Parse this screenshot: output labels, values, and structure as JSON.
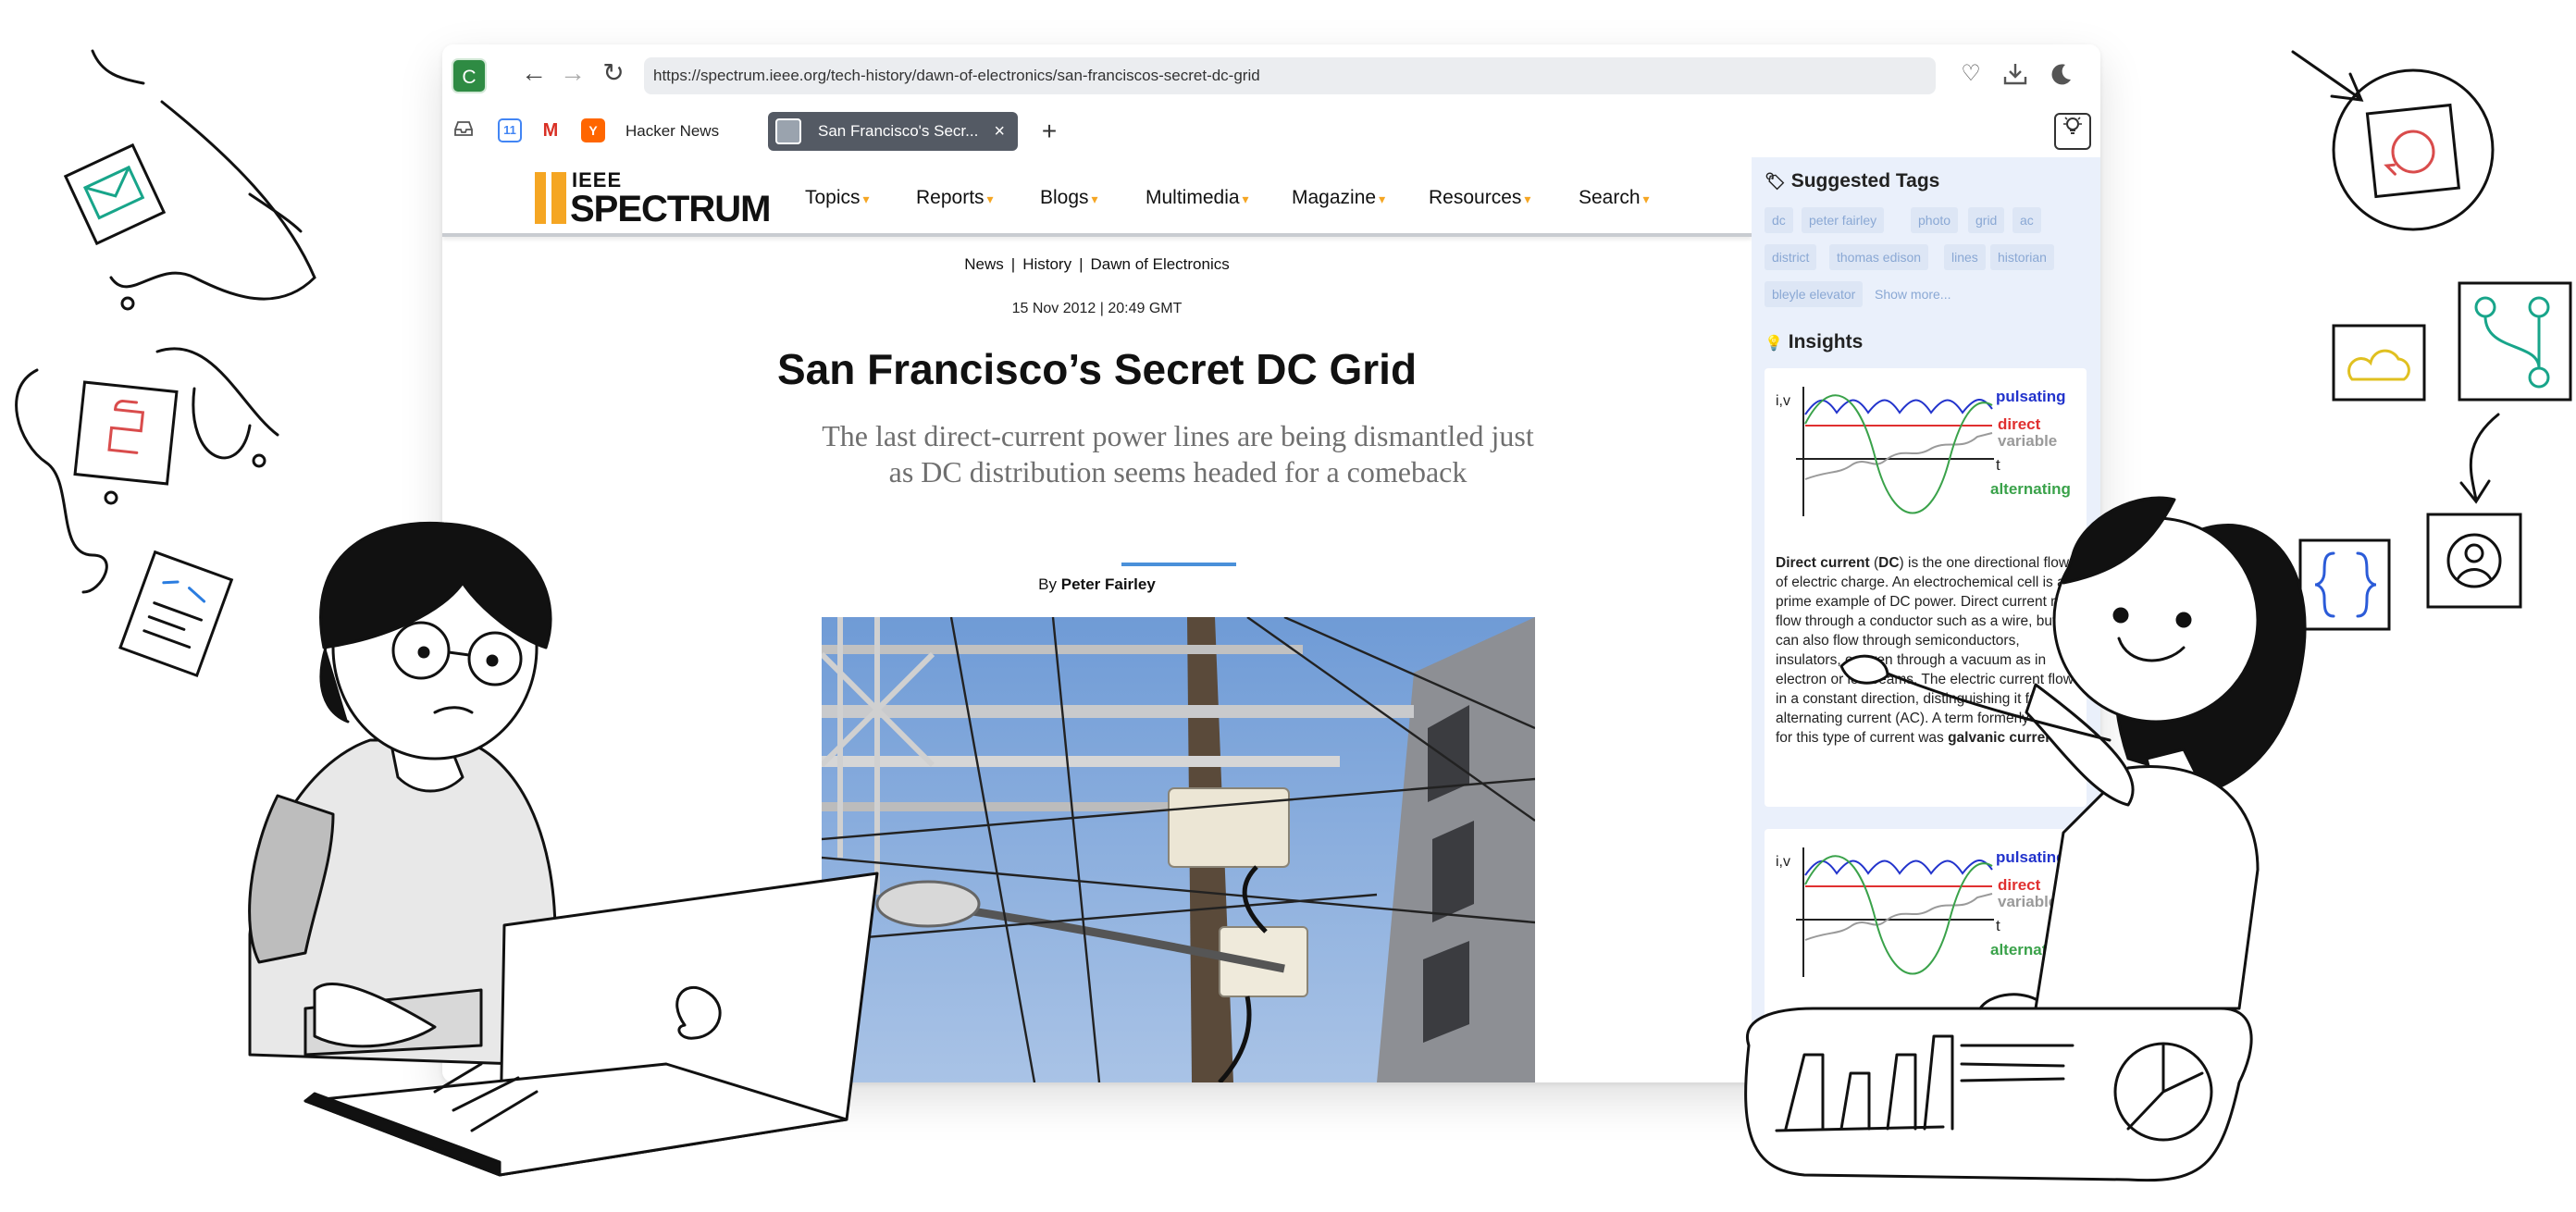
{
  "browser": {
    "extension_badge": "C",
    "url": "https://spectrum.ieee.org/tech-history/dawn-of-electronics/san-franciscos-secret-dc-grid"
  },
  "tabs": {
    "pinned": [
      {
        "icon": "inbox-icon"
      },
      {
        "icon": "calendar-icon",
        "text": "11"
      },
      {
        "icon": "gmail-icon",
        "text": "M"
      },
      {
        "icon": "hacker-news-icon",
        "text": "Y"
      }
    ],
    "hn_label": "Hacker News",
    "active_label": "San Francisco's Secr...",
    "close_glyph": "×",
    "new_tab_glyph": "+"
  },
  "site": {
    "logo_top": "IEEE",
    "logo_bottom": "SPECTRUM",
    "nav": [
      "Topics",
      "Reports",
      "Blogs",
      "Multimedia",
      "Magazine",
      "Resources",
      "Search"
    ]
  },
  "article": {
    "breadcrumbs": [
      "News",
      "History",
      "Dawn of Electronics"
    ],
    "dateline": "15 Nov 2012 | 20:49 GMT",
    "title": "San Francisco’s Secret DC Grid",
    "subtitle": "The last direct-current power lines are being dismantled just as DC distribution seems headed for a comeback",
    "byline_prefix": "By",
    "author": "Peter Fairley"
  },
  "sidebar": {
    "tags_title": "Suggested Tags",
    "tags": [
      "dc",
      "peter fairley",
      "photo",
      "grid",
      "ac",
      "district",
      "thomas edison",
      "lines",
      "historian",
      "bleyle elevator"
    ],
    "show_more": "Show more...",
    "insights_title": "Insights",
    "chart_labels": {
      "axis": "i,v",
      "pulsating": "pulsating",
      "direct": "direct",
      "variable": "variable",
      "t": "t",
      "alternating": "alternating"
    },
    "insight_text": {
      "p1_bold": "Direct current",
      "p1_abbr": "DC",
      "p1_rest": " is the one directional flow of electric charge. An electrochemical cell is a prime example of DC power. Direct current may flow through a conductor such as a wire, but can also flow through semiconductors, insulators, or even through a vacuum as in electron or ion beams. The electric current flows in a constant direction, distinguishing it from alternating current (AC). A term formerly used for this type of current was ",
      "p1_bold2": "galvanic current",
      "p1_end": "."
    }
  },
  "colors": {
    "accent_orange": "#f5a623",
    "pulsating": "#2233cc",
    "direct": "#e03030",
    "variable": "#9a9a9a",
    "alternating": "#3aa24a",
    "sidebar_bg": "#eaf0fb"
  }
}
